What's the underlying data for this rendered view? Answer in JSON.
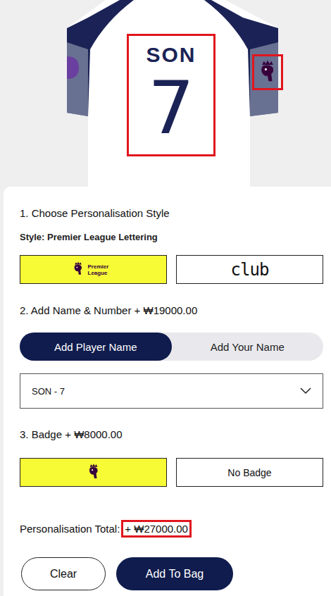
{
  "preview": {
    "name": "SON",
    "number": "7"
  },
  "style_section": {
    "title": "1. Choose Personalisation Style",
    "style_label": "Style: Premier League Lettering",
    "options": [
      {
        "kind": "logo",
        "label": "Premier League",
        "selected": true
      },
      {
        "kind": "club",
        "label": "club",
        "selected": false
      }
    ]
  },
  "name_section": {
    "title": "2. Add Name & Number + ₩19000.00",
    "modes": [
      {
        "label": "Add Player Name",
        "selected": true
      },
      {
        "label": "Add Your Name",
        "selected": false
      }
    ],
    "dropdown": {
      "value": "SON - 7"
    }
  },
  "badge_section": {
    "title": "3. Badge + ₩8000.00",
    "options": [
      {
        "kind": "icon",
        "label": "",
        "selected": true
      },
      {
        "kind": "text",
        "label": "No Badge",
        "selected": false
      }
    ]
  },
  "total": {
    "label": "Personalisation Total:",
    "amount": "+ ₩27000.00"
  },
  "buttons": [
    "Clear",
    "Add To Bag"
  ]
}
